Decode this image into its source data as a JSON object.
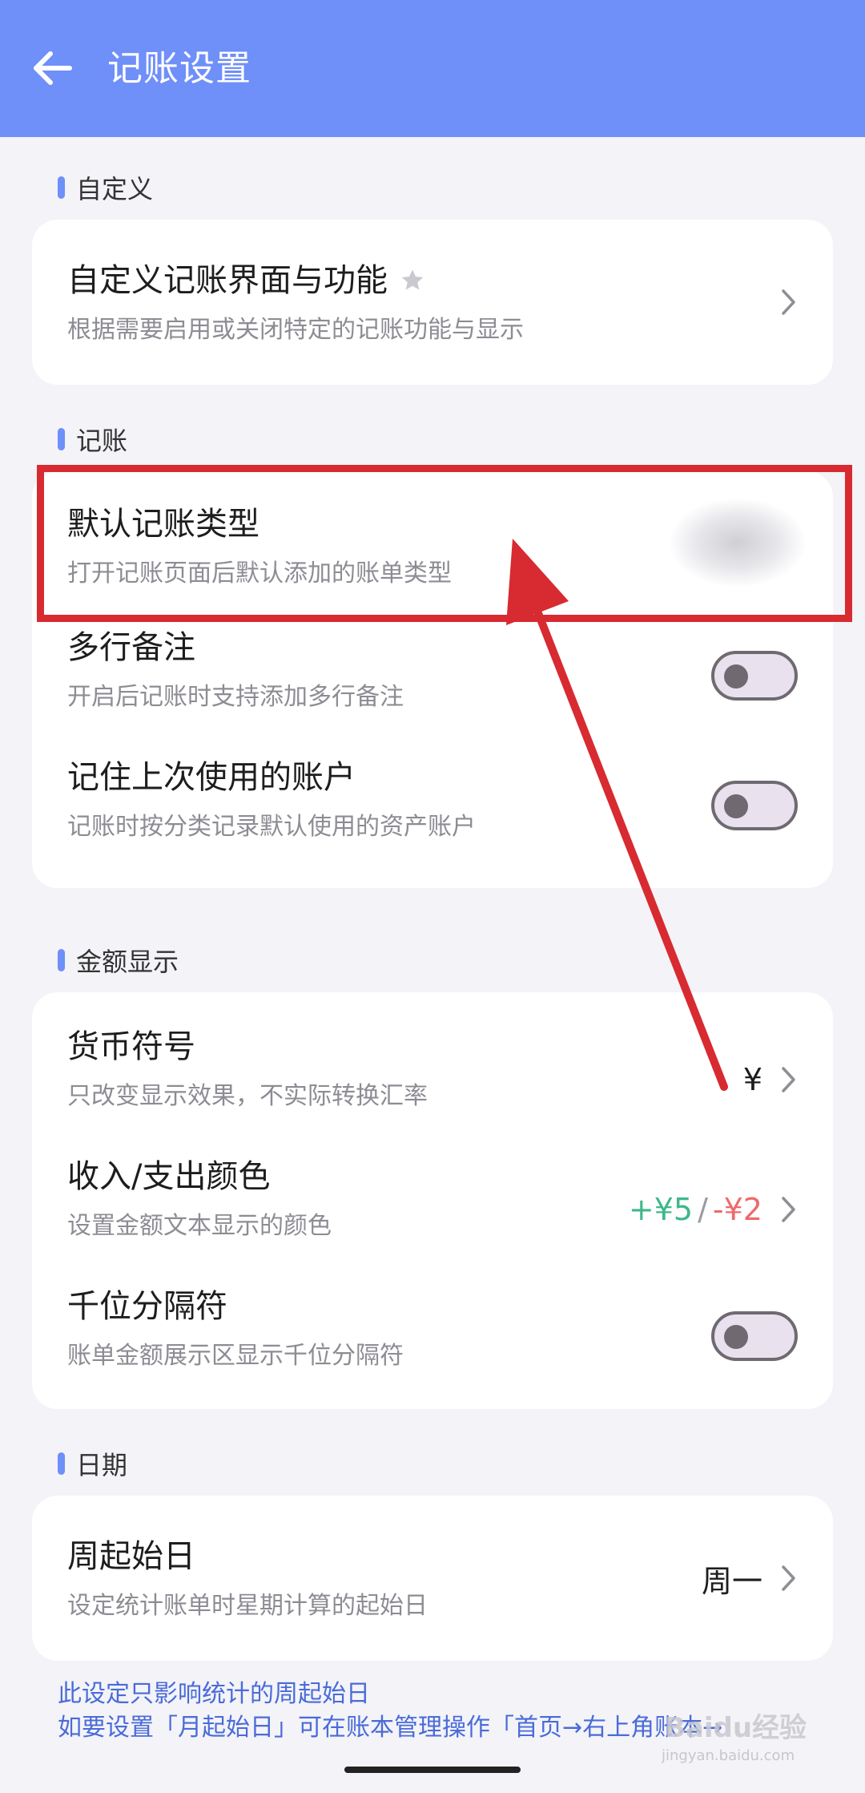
{
  "header": {
    "title": "记账设置"
  },
  "sections": {
    "custom": {
      "label": "自定义"
    },
    "bookkeeping": {
      "label": "记账"
    },
    "amount": {
      "label": "金额显示"
    },
    "date": {
      "label": "日期"
    }
  },
  "rows": {
    "custom_ui": {
      "title": "自定义记账界面与功能",
      "subtitle": "根据需要启用或关闭特定的记账功能与显示"
    },
    "default_type": {
      "title": "默认记账类型",
      "subtitle": "打开记账页面后默认添加的账单类型"
    },
    "multiline_note": {
      "title": "多行备注",
      "subtitle": "开启后记账时支持添加多行备注",
      "enabled": false
    },
    "remember_account": {
      "title": "记住上次使用的账户",
      "subtitle": "记账时按分类记录默认使用的资产账户",
      "enabled": false
    },
    "currency": {
      "title": "货币符号",
      "subtitle": "只改变显示效果，不实际转换汇率",
      "value": "¥"
    },
    "colors": {
      "title": "收入/支出颜色",
      "subtitle": "设置金额文本显示的颜色",
      "income_text": "+¥5",
      "separator": "/",
      "expense_text": "-¥2",
      "income_color": "#3fb88a",
      "expense_color": "#ee6a6a"
    },
    "thousands": {
      "title": "千位分隔符",
      "subtitle": "账单金额展示区显示千位分隔符",
      "enabled": false
    },
    "week_start": {
      "title": "周起始日",
      "subtitle": "设定统计账单时星期计算的起始日",
      "value": "周一"
    }
  },
  "note": {
    "line1": "此设定只影响统计的周起始日",
    "line2": "如要设置「月起始日」可在账本管理操作「首页→右上角账本→"
  },
  "watermark": {
    "text": "Baidu经验",
    "sub": "jingyan.baidu.com"
  },
  "colors": {
    "header": "#6f8ff9",
    "accent": "#6f8ff9",
    "annotation": "#d82a31"
  },
  "icons": {
    "back": "arrow-left-icon",
    "star": "star-icon",
    "chevron": "chevron-right-icon"
  }
}
